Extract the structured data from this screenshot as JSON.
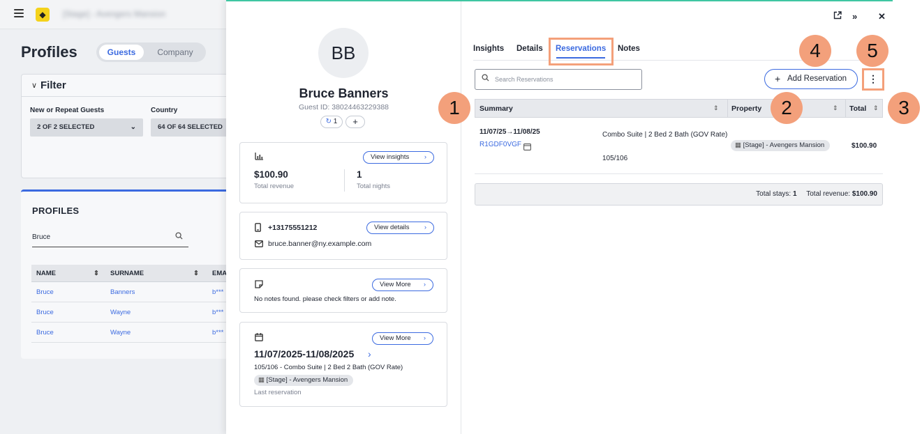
{
  "bg": {
    "logo_glyph": "◆",
    "blurred_crumb": "[Stage] - Avengers Mansion",
    "page_title": "Profiles",
    "segment": {
      "guests": "Guests",
      "company": "Company"
    },
    "filter": {
      "title": "Filter",
      "label1": "New or Repeat Guests",
      "value1": "2 OF 2 SELECTED",
      "label2": "Country",
      "value2": "64 OF 64 SELECTED"
    },
    "profiles": {
      "title": "PROFILES",
      "search_value": "Bruce",
      "headers": [
        "NAME",
        "SURNAME",
        "EMA"
      ],
      "rows": [
        {
          "name": "Bruce",
          "surname": "Banners",
          "email": "b***"
        },
        {
          "name": "Bruce",
          "surname": "Wayne",
          "email": "b***"
        },
        {
          "name": "Bruce",
          "surname": "Wayne",
          "email": "b***"
        }
      ]
    }
  },
  "guest": {
    "initials": "BB",
    "name": "Bruce Banners",
    "guest_id": "Guest ID: 38024463229388",
    "stays_badge": "1",
    "add_badge": "+",
    "insights": {
      "button": "View insights",
      "revenue": "$100.90",
      "revenue_label": "Total revenue",
      "nights": "1",
      "nights_label": "Total nights"
    },
    "contact": {
      "phone": "+13175551212",
      "button": "View details",
      "email": "bruce.banner@ny.example.com"
    },
    "notes": {
      "button": "View More",
      "text": "No notes found. please check filters or add note."
    },
    "last_res": {
      "button": "View More",
      "dates": "11/07/2025-11/08/2025",
      "room": "105/106 - Combo Suite | 2 Bed 2 Bath (GOV Rate)",
      "property": "[Stage] - Avengers Mansion",
      "label": "Last reservation"
    }
  },
  "panel": {
    "tabs": [
      "Insights",
      "Details",
      "Reservations",
      "Notes"
    ],
    "active_tab": "Reservations",
    "search_placeholder": "Search Reservations",
    "add_button": "Add Reservation",
    "kebab": "⋮",
    "columns": [
      "Summary",
      "Property",
      "Total"
    ],
    "reservation": {
      "dates": "11/07/25→11/08/25",
      "confirmation": "R1GDF0VGF",
      "room_type": "Combo Suite | 2 Bed 2 Bath (GOV Rate)",
      "room_numbers": "105/106",
      "property": "[Stage] - Avengers Mansion",
      "total": "$100.90"
    },
    "footer": {
      "stays_label": "Total stays:",
      "stays_value": "1",
      "revenue_label": "Total revenue:",
      "revenue_value": "$100.90"
    }
  },
  "annotations": [
    "1",
    "2",
    "3",
    "4",
    "5"
  ],
  "colors": {
    "accent": "#3b6ae0",
    "highlight": "#f4a07a",
    "drawer_top": "#3fc6a2"
  }
}
